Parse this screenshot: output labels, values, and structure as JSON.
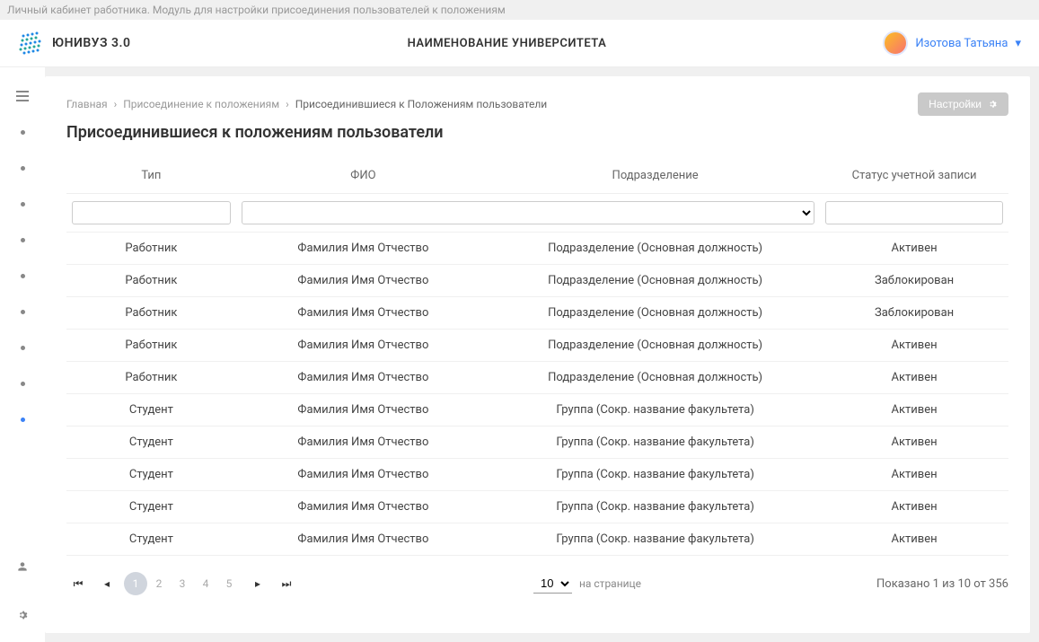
{
  "topNote": "Личный кабинет работника. Модуль для настройки присоединения пользователей к положениям",
  "logo": "ЮНИВУЗ 3.0",
  "universityName": "НАИМЕНОВАНИЕ УНИВЕРСИТЕТА",
  "userName": "Изотова Татьяна",
  "breadcrumbs": {
    "home": "Главная",
    "mid": "Присоединение к положениям",
    "current": "Присоединившиеся к Положениям пользователи"
  },
  "settingsBtn": "Настройки",
  "pageTitle": "Присоединившиеся к положениям пользователи",
  "columns": {
    "type": "Тип",
    "fio": "ФИО",
    "dept": "Подразделение",
    "status": "Статус учетной записи"
  },
  "rows": [
    {
      "type": "Работник",
      "fio": "Фамилия Имя Отчество",
      "dept": "Подразделение (Основная должность)",
      "status": "Активен"
    },
    {
      "type": "Работник",
      "fio": "Фамилия Имя Отчество",
      "dept": "Подразделение (Основная должность)",
      "status": "Заблокирован"
    },
    {
      "type": "Работник",
      "fio": "Фамилия Имя Отчество",
      "dept": "Подразделение (Основная должность)",
      "status": "Заблокирован"
    },
    {
      "type": "Работник",
      "fio": "Фамилия Имя Отчество",
      "dept": "Подразделение (Основная должность)",
      "status": "Активен"
    },
    {
      "type": "Работник",
      "fio": "Фамилия Имя Отчество",
      "dept": "Подразделение (Основная должность)",
      "status": "Активен"
    },
    {
      "type": "Студент",
      "fio": "Фамилия Имя Отчество",
      "dept": "Группа (Сокр. название факультета)",
      "status": "Активен"
    },
    {
      "type": "Студент",
      "fio": "Фамилия Имя Отчество",
      "dept": "Группа (Сокр. название факультета)",
      "status": "Активен"
    },
    {
      "type": "Студент",
      "fio": "Фамилия Имя Отчество",
      "dept": "Группа (Сокр. название факультета)",
      "status": "Активен"
    },
    {
      "type": "Студент",
      "fio": "Фамилия Имя Отчество",
      "dept": "Группа (Сокр. название факультета)",
      "status": "Активен"
    },
    {
      "type": "Студент",
      "fio": "Фамилия Имя Отчество",
      "dept": "Группа (Сокр. название факультета)",
      "status": "Активен"
    }
  ],
  "pager": {
    "pages": [
      "1",
      "2",
      "3",
      "4",
      "5"
    ],
    "perPage": "10",
    "perPageLabel": "на странице",
    "summary": "Показано 1 из 10 от 356"
  }
}
